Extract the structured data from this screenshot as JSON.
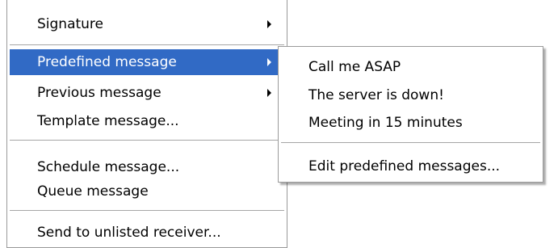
{
  "main_menu": {
    "items": [
      {
        "label": "Signature"
      },
      {
        "label": "Predefined message"
      },
      {
        "label": "Previous message"
      },
      {
        "label": "Template message..."
      },
      {
        "label": "Schedule message..."
      },
      {
        "label": "Queue message"
      },
      {
        "label": "Send to unlisted receiver..."
      }
    ]
  },
  "submenu": {
    "items": [
      {
        "label": "Call me ASAP"
      },
      {
        "label": "The server is down!"
      },
      {
        "label": "Meeting in 15 minutes"
      },
      {
        "label": "Edit predefined messages..."
      }
    ]
  },
  "colors": {
    "highlight": "#316ac5",
    "highlight_text": "#ffffff",
    "text": "#000000",
    "separator": "#a6a6a6",
    "border": "#9a9a9a"
  },
  "icons": {
    "submenu_arrow": "submenu-arrow-icon"
  }
}
